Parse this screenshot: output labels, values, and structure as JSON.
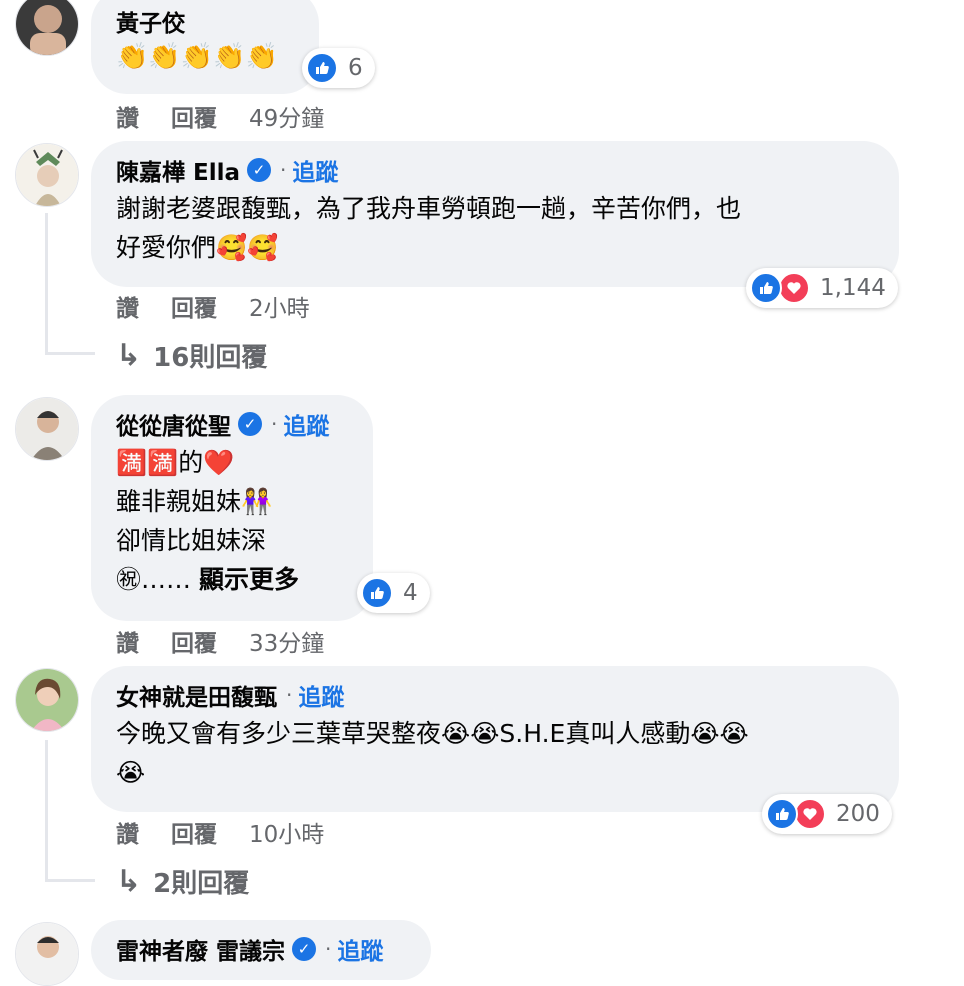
{
  "comments": [
    {
      "name": "黃子佼",
      "text": "👏👏👏👏👏",
      "reaction_count": "6",
      "actions": {
        "like": "讚",
        "reply": "回覆",
        "time": "49分鐘"
      }
    },
    {
      "name": "陳嘉樺 Ella",
      "dot": "·",
      "follow": "追蹤",
      "text": "謝謝老婆跟馥甄，為了我舟車勞頓跑一趟，辛苦你們，也\n好愛你們🥰🥰",
      "reaction_count": "1,144",
      "actions": {
        "like": "讚",
        "reply": "回覆",
        "time": "2小時"
      },
      "replies": "16則回覆"
    },
    {
      "name": "從從唐從聖",
      "dot": "·",
      "follow": "追蹤",
      "text": "🈵🈵的❤️\n雖非親姐妹👭\n卻情比姐妹深\n㊗……",
      "more": "顯示更多",
      "reaction_count": "4",
      "actions": {
        "like": "讚",
        "reply": "回覆",
        "time": "33分鐘"
      }
    },
    {
      "name": "女神就是田馥甄",
      "dot": "·",
      "follow": "追蹤",
      "text": "今晚又會有多少三葉草哭整夜😭😭S.H.E真叫人感動😭😭\n😭",
      "reaction_count": "200",
      "actions": {
        "like": "讚",
        "reply": "回覆",
        "time": "10小時"
      },
      "replies": "2則回覆"
    },
    {
      "name": "雷神者廢 雷議宗",
      "dot": "·",
      "follow": "追蹤"
    }
  ],
  "reply_arrow": "↳",
  "icons": {
    "like": "like-icon",
    "love": "love-icon",
    "verified": "verified-badge-icon"
  },
  "colors": {
    "accent": "#1b74e4",
    "love": "#f33e58",
    "bubble": "#f0f2f5",
    "muted": "#65676b"
  }
}
